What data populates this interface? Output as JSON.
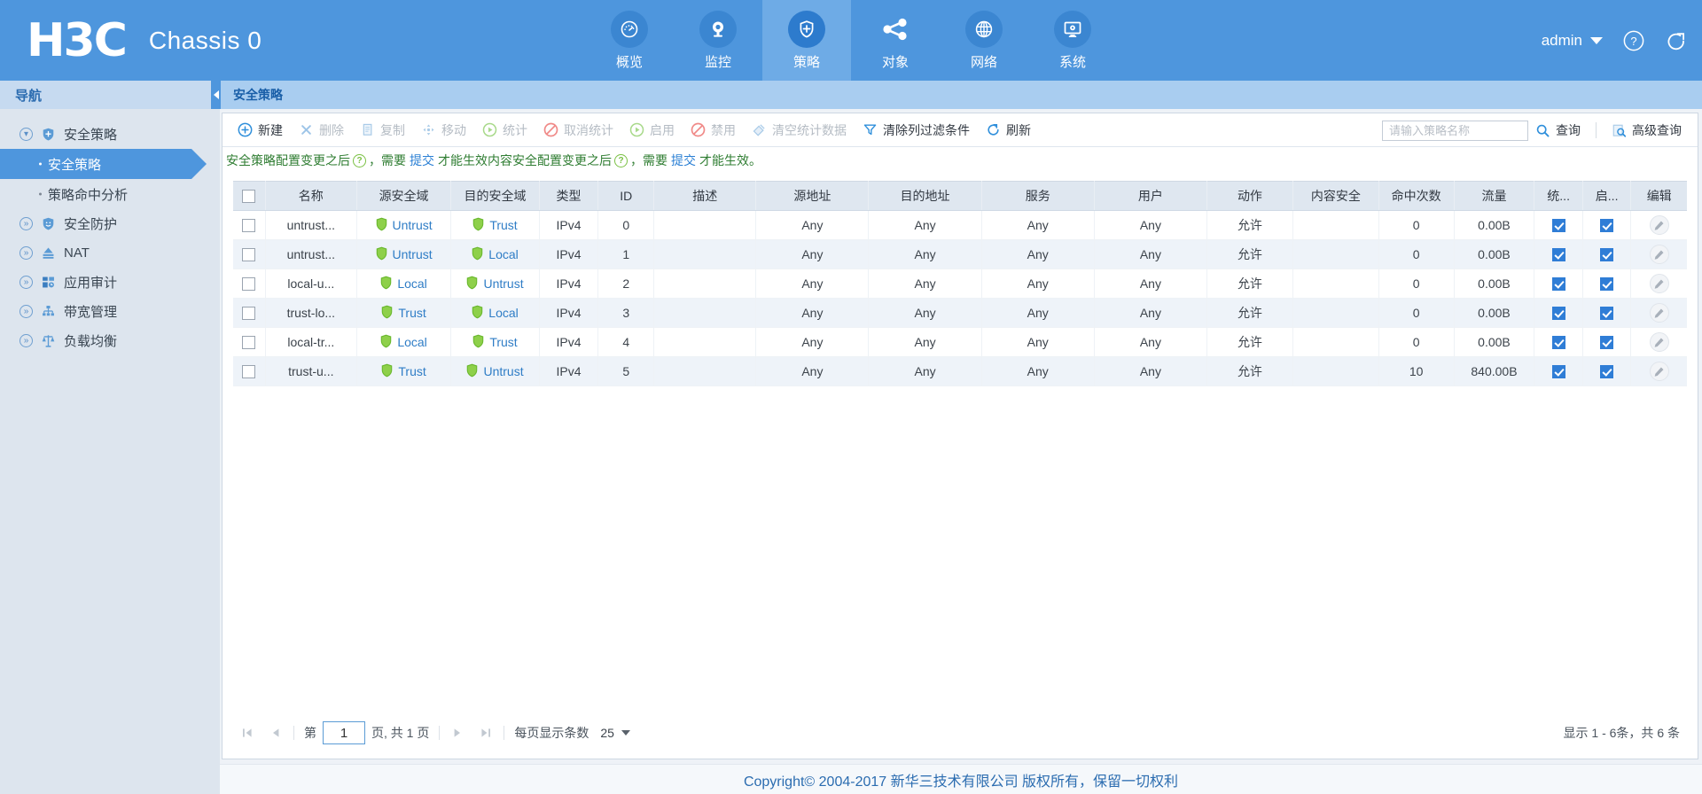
{
  "header": {
    "logo": "H3C",
    "chassis": "Chassis 0",
    "admin_label": "admin",
    "help_icon": "help-circle-icon",
    "logout_icon": "logout-icon",
    "modules": [
      {
        "label": "概览",
        "icon": "gauge-icon",
        "active": false
      },
      {
        "label": "监控",
        "icon": "monitor-eye-icon",
        "active": false
      },
      {
        "label": "策略",
        "icon": "shield-plus-icon",
        "active": true
      },
      {
        "label": "对象",
        "icon": "share-nodes-icon",
        "active": false
      },
      {
        "label": "网络",
        "icon": "globe-icon",
        "active": false
      },
      {
        "label": "系统",
        "icon": "desktop-gear-icon",
        "active": false
      }
    ]
  },
  "sidebar": {
    "title": "导航",
    "collapse_icon": "chevron-left-icon",
    "groups": [
      {
        "label": "安全策略",
        "icon": "shield-plus-icon",
        "expanded": true,
        "children": [
          {
            "label": "安全策略",
            "selected": true
          },
          {
            "label": "策略命中分析",
            "selected": false
          }
        ]
      },
      {
        "label": "安全防护",
        "icon": "shield-face-icon",
        "expanded": false,
        "children": []
      },
      {
        "label": "NAT",
        "icon": "nat-icon",
        "expanded": false,
        "children": []
      },
      {
        "label": "应用审计",
        "icon": "apps-audit-icon",
        "expanded": false,
        "children": []
      },
      {
        "label": "带宽管理",
        "icon": "bandwidth-icon",
        "expanded": false,
        "children": []
      },
      {
        "label": "负载均衡",
        "icon": "balance-scale-icon",
        "expanded": false,
        "children": []
      }
    ]
  },
  "breadcrumb": "安全策略",
  "toolbar": {
    "buttons": [
      {
        "label": "新建",
        "icon": "plus-circle-icon",
        "enabled": true
      },
      {
        "label": "删除",
        "icon": "x-icon",
        "enabled": false
      },
      {
        "label": "复制",
        "icon": "copy-icon",
        "enabled": false
      },
      {
        "label": "移动",
        "icon": "move-icon",
        "enabled": false
      },
      {
        "label": "统计",
        "icon": "play-circle-icon",
        "enabled": false
      },
      {
        "label": "取消统计",
        "icon": "ban-icon",
        "enabled": false
      },
      {
        "label": "启用",
        "icon": "play-circle-icon",
        "enabled": false
      },
      {
        "label": "禁用",
        "icon": "ban-icon",
        "enabled": false
      },
      {
        "label": "清空统计数据",
        "icon": "eraser-icon",
        "enabled": false
      },
      {
        "label": "清除列过滤条件",
        "icon": "filter-icon",
        "enabled": true
      },
      {
        "label": "刷新",
        "icon": "refresh-icon",
        "enabled": true
      }
    ],
    "search_placeholder": "请输入策略名称",
    "search_value": "",
    "query_label": "查询",
    "query_icon": "search-icon",
    "advanced_label": "高级查询",
    "advanced_icon": "advanced-search-icon"
  },
  "notice": {
    "part1": "安全策略配置变更之后",
    "link1": "提交",
    "part2": "，需要",
    "part3": "才能生效内容安全配置变更之后",
    "link2": "提交",
    "part4": "，需要",
    "part5": "才能生效。",
    "help_icon": "question-circle-icon"
  },
  "table": {
    "columns": [
      "名称",
      "源安全域",
      "目的安全域",
      "类型",
      "ID",
      "描述",
      "源地址",
      "目的地址",
      "服务",
      "用户",
      "动作",
      "内容安全",
      "命中次数",
      "流量",
      "统...",
      "启...",
      "编辑"
    ],
    "rows": [
      {
        "name": "untrust...",
        "src_zone": "Untrust",
        "dst_zone": "Trust",
        "type": "IPv4",
        "id": "0",
        "desc": "",
        "src_addr": "Any",
        "dst_addr": "Any",
        "service": "Any",
        "user": "Any",
        "action": "允许",
        "content_sec": "",
        "hits": "0",
        "traffic": "0.00B",
        "stat_checked": true,
        "enable_checked": true,
        "edit_icon": "pencil-icon"
      },
      {
        "name": "untrust...",
        "src_zone": "Untrust",
        "dst_zone": "Local",
        "type": "IPv4",
        "id": "1",
        "desc": "",
        "src_addr": "Any",
        "dst_addr": "Any",
        "service": "Any",
        "user": "Any",
        "action": "允许",
        "content_sec": "",
        "hits": "0",
        "traffic": "0.00B",
        "stat_checked": true,
        "enable_checked": true,
        "edit_icon": "pencil-icon"
      },
      {
        "name": "local-u...",
        "src_zone": "Local",
        "dst_zone": "Untrust",
        "type": "IPv4",
        "id": "2",
        "desc": "",
        "src_addr": "Any",
        "dst_addr": "Any",
        "service": "Any",
        "user": "Any",
        "action": "允许",
        "content_sec": "",
        "hits": "0",
        "traffic": "0.00B",
        "stat_checked": true,
        "enable_checked": true,
        "edit_icon": "pencil-icon"
      },
      {
        "name": "trust-lo...",
        "src_zone": "Trust",
        "dst_zone": "Local",
        "type": "IPv4",
        "id": "3",
        "desc": "",
        "src_addr": "Any",
        "dst_addr": "Any",
        "service": "Any",
        "user": "Any",
        "action": "允许",
        "content_sec": "",
        "hits": "0",
        "traffic": "0.00B",
        "stat_checked": true,
        "enable_checked": true,
        "edit_icon": "pencil-icon"
      },
      {
        "name": "local-tr...",
        "src_zone": "Local",
        "dst_zone": "Trust",
        "type": "IPv4",
        "id": "4",
        "desc": "",
        "src_addr": "Any",
        "dst_addr": "Any",
        "service": "Any",
        "user": "Any",
        "action": "允许",
        "content_sec": "",
        "hits": "0",
        "traffic": "0.00B",
        "stat_checked": true,
        "enable_checked": true,
        "edit_icon": "pencil-icon"
      },
      {
        "name": "trust-u...",
        "src_zone": "Trust",
        "dst_zone": "Untrust",
        "type": "IPv4",
        "id": "5",
        "desc": "",
        "src_addr": "Any",
        "dst_addr": "Any",
        "service": "Any",
        "user": "Any",
        "action": "允许",
        "content_sec": "",
        "hits": "10",
        "traffic": "840.00B",
        "stat_checked": true,
        "enable_checked": true,
        "edit_icon": "pencil-icon"
      }
    ]
  },
  "pager": {
    "first_icon": "first-page-icon",
    "prev_icon": "prev-page-icon",
    "next_icon": "next-page-icon",
    "last_icon": "last-page-icon",
    "page_prefix": "第",
    "page_value": "1",
    "page_suffix": "页, 共 1 页",
    "size_label": "每页显示条数",
    "size_value": "25",
    "count_text": "显示 1 - 6条，共 6 条"
  },
  "footer": "Copyright© 2004-2017 新华三技术有限公司 版权所有，保留一切权利",
  "colors": {
    "brand_blue": "#4e96dd",
    "accent_blue": "#2f7dc6",
    "allow_green": "#4c9c3f",
    "sidebar_bg": "#dde5ee",
    "breadcrumb_bg": "#a9cdf0"
  }
}
